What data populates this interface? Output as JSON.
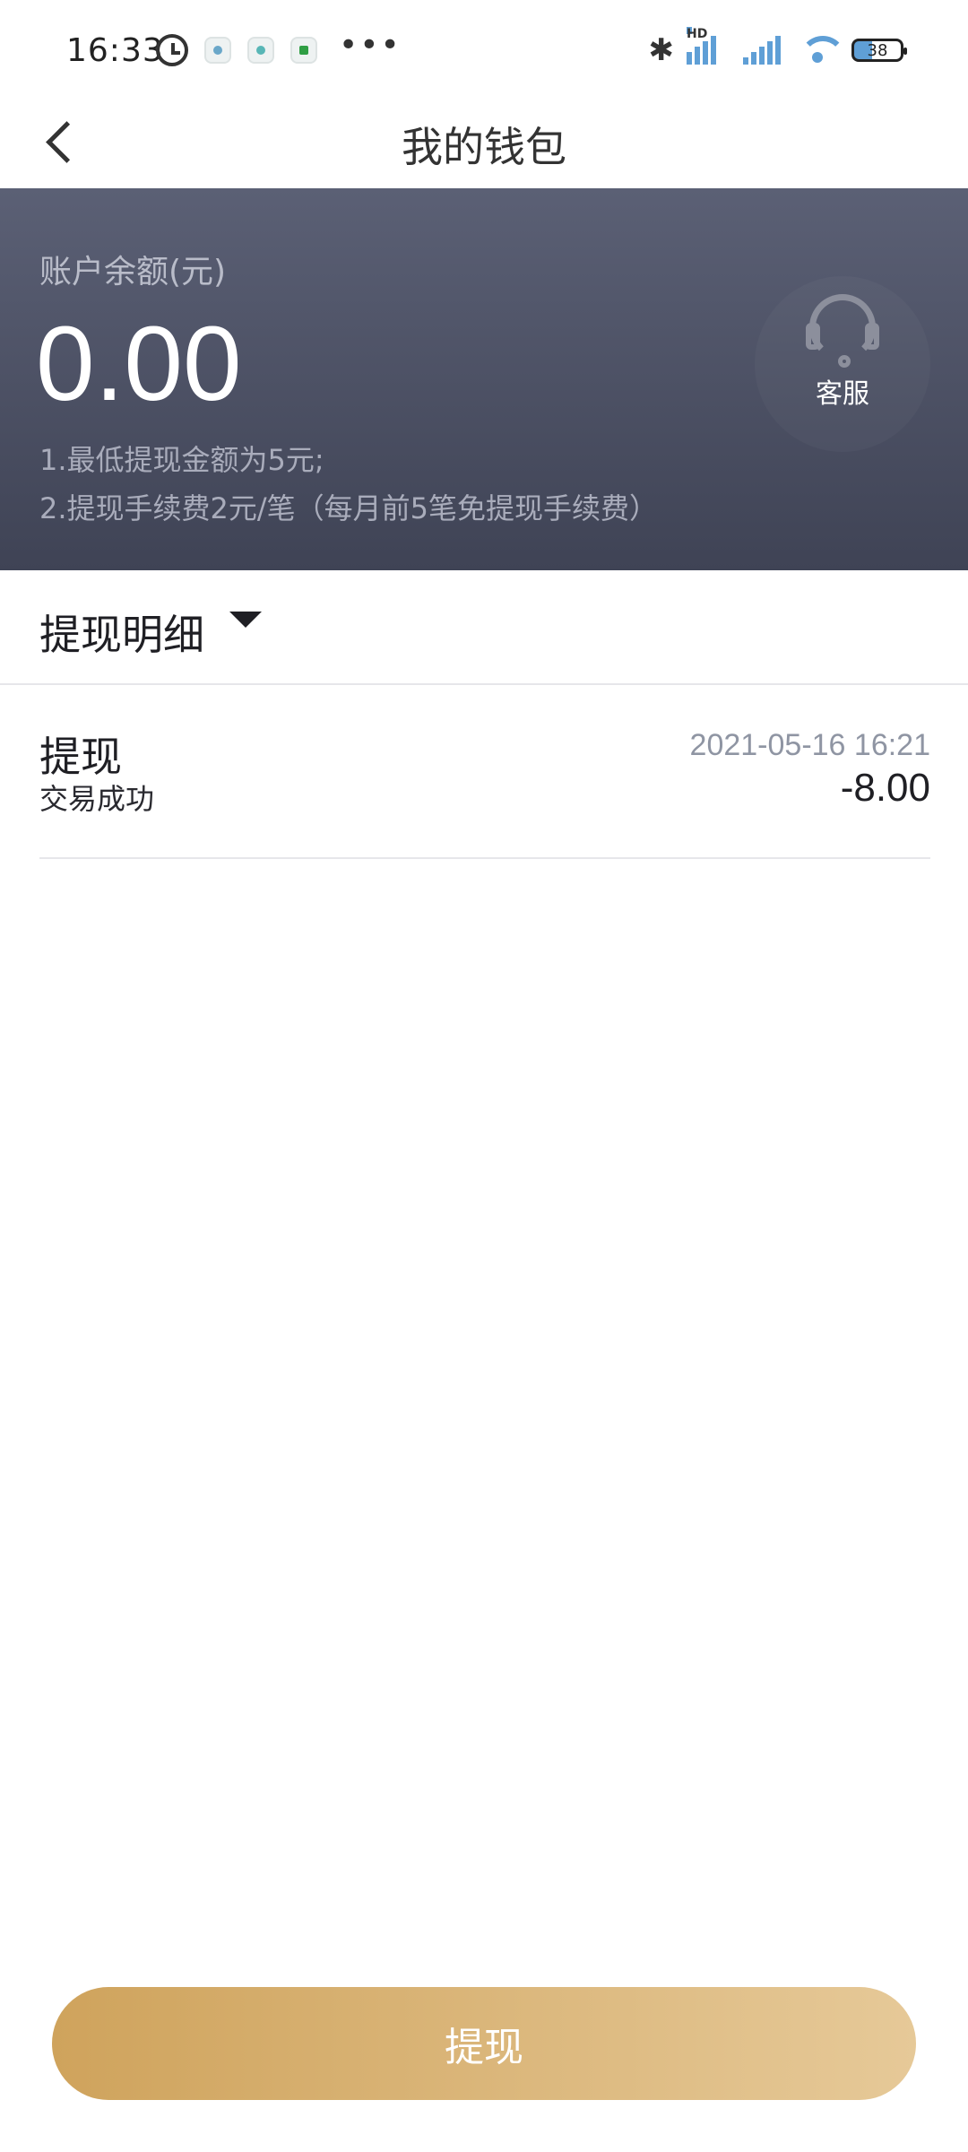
{
  "status_bar": {
    "time": "16:33",
    "more": "•••",
    "bluetooth": "✱",
    "hd": "HD",
    "battery": "38"
  },
  "nav": {
    "title": "我的钱包"
  },
  "balance": {
    "label": "账户余额(元)",
    "value": "0.00",
    "note1": "1.最低提现金额为5元;",
    "note2": "2.提现手续费2元/笔（每月前5笔免提现手续费）",
    "service_label": "客服"
  },
  "section": {
    "title": "提现明细"
  },
  "transactions": [
    {
      "type": "提现",
      "status": "交易成功",
      "time": "2021-05-16 16:21",
      "amount": "-8.00"
    }
  ],
  "footer": {
    "withdraw_label": "提现"
  },
  "colors": {
    "card_top": "#5b6075",
    "card_bottom": "#3f4355",
    "button_start": "#cfa35c",
    "button_end": "#e6c998"
  }
}
